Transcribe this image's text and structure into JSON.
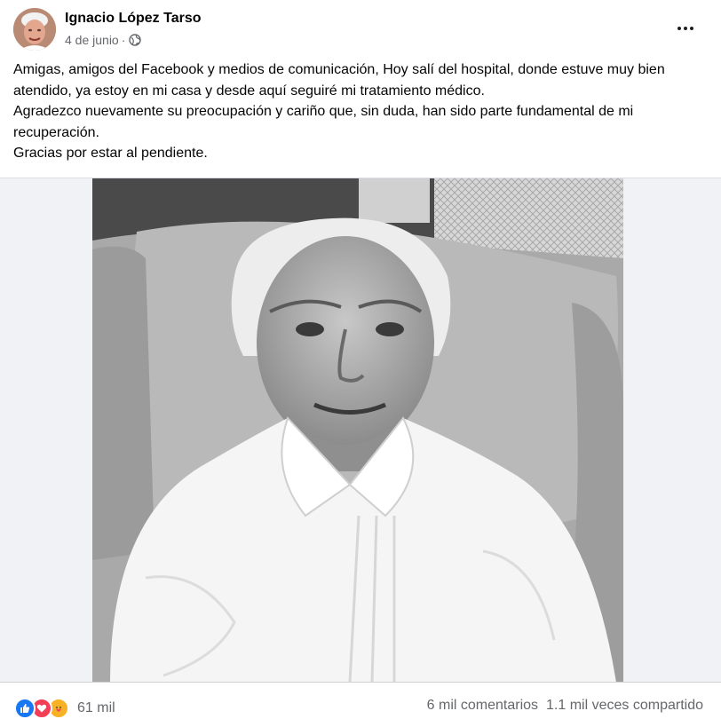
{
  "post": {
    "author": "Ignacio López Tarso",
    "date": "4 de junio",
    "separator": "·",
    "privacy_icon": "globe-icon",
    "more_icon": "more-horizontal-icon",
    "text_lines": [
      "Amigas, amigos del Facebook y medios de comunicación, Hoy salí del hospital, donde estuve muy bien atendido, ya estoy en mi casa y desde aquí seguiré mi tratamiento médico.",
      "Agradezco nuevamente su preocupación y cariño que, sin duda, han sido parte fundamental de mi recuperación.",
      "Gracias por estar al pendiente."
    ]
  },
  "footer": {
    "reactions": [
      "like-icon",
      "love-icon",
      "care-icon"
    ],
    "reaction_count": "61 mil",
    "comments": "6 mil comentarios",
    "shares": "1.1 mil veces compartido"
  },
  "colors": {
    "text_primary": "#050505",
    "text_secondary": "#65676b",
    "like_blue": "#1877f2",
    "love_red": "#f33e58",
    "care_yellow": "#f7b125",
    "photo_bg": "#f0f2f5"
  }
}
